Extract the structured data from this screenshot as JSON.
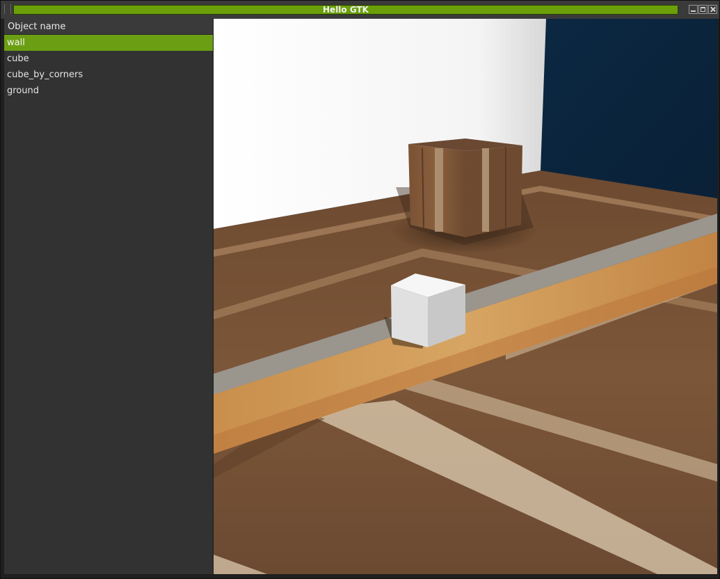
{
  "window": {
    "title": "Hello GTK"
  },
  "sidebar": {
    "column_header": "Object name",
    "items": [
      {
        "label": "wall",
        "selected": true
      },
      {
        "label": "cube",
        "selected": false
      },
      {
        "label": "cube_by_corners",
        "selected": false
      },
      {
        "label": "ground",
        "selected": false
      }
    ]
  },
  "colors": {
    "accent": "#6b9e12",
    "panel": "#323232",
    "sky": "#0d2a44"
  },
  "viewport": {
    "scene_objects": [
      "wall",
      "cube",
      "cube_by_corners",
      "ground"
    ]
  }
}
